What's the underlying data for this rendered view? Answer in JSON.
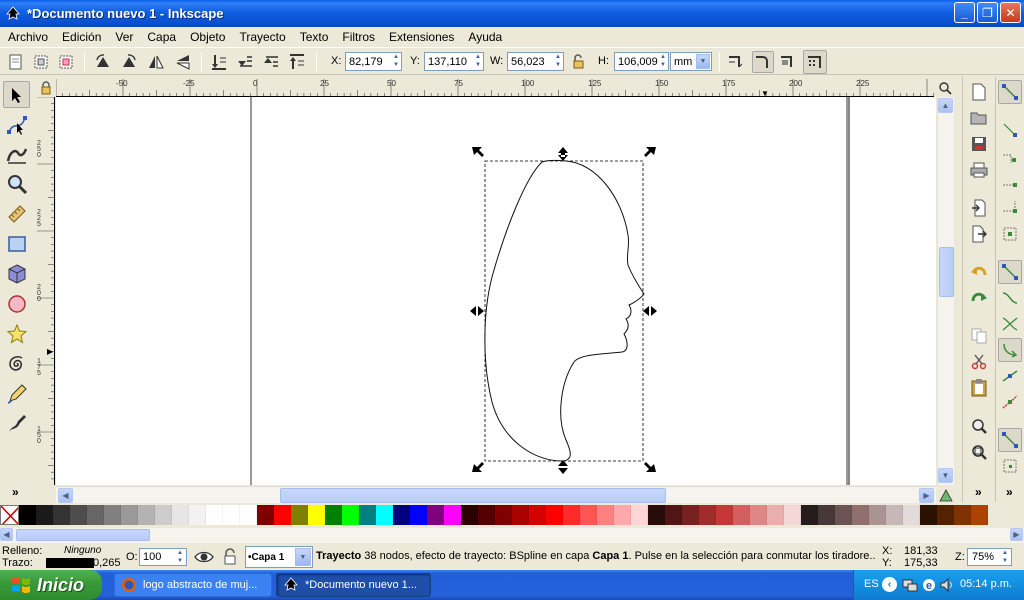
{
  "window": {
    "title": "*Documento nuevo 1 - Inkscape",
    "controls": [
      "_",
      "❐",
      "✕"
    ]
  },
  "menu": [
    "Archivo",
    "Edición",
    "Ver",
    "Capa",
    "Objeto",
    "Trayecto",
    "Texto",
    "Filtros",
    "Extensiones",
    "Ayuda"
  ],
  "controls": {
    "x_label": "X:",
    "x_value": "82,179",
    "y_label": "Y:",
    "y_value": "137,110",
    "w_label": "W:",
    "w_value": "56,023",
    "h_label": "H:",
    "h_value": "106,009",
    "unit": "mm"
  },
  "ruler": {
    "h_labels": [
      "-50",
      "-25",
      "0",
      "25",
      "50",
      "75",
      "100",
      "125",
      "150",
      "175",
      "200",
      "225"
    ],
    "v_labels": [
      "2 5 0",
      "2 2 5",
      "2 0 0",
      "1 7 5",
      "1 5 0"
    ]
  },
  "palette": {
    "colors": [
      "#000000",
      "#1a1a1a",
      "#333333",
      "#4d4d4d",
      "#666666",
      "#808080",
      "#999999",
      "#b3b3b3",
      "#cccccc",
      "#e6e6e6",
      "#f2f2f2",
      "#ffffff",
      "#ffffff",
      "#ffffff",
      "#800000",
      "#ff0000",
      "#808000",
      "#ffff00",
      "#008000",
      "#00ff00",
      "#008080",
      "#00ffff",
      "#000080",
      "#0000ff",
      "#800080",
      "#ff00ff",
      "#2b0000",
      "#550000",
      "#800000",
      "#aa0000",
      "#d40000",
      "#ff0000",
      "#ff2a2a",
      "#ff5555",
      "#ff8080",
      "#ffaaaa",
      "#ffd5d5",
      "#280b0b",
      "#501616",
      "#782121",
      "#a02c2c",
      "#c83737",
      "#d35f5f",
      "#de8787",
      "#e9afaf",
      "#f4d7d7",
      "#241c1c",
      "#483737",
      "#6c5353",
      "#916f6f",
      "#ac9393",
      "#c8b7b7",
      "#e3dbdb",
      "#2b1100",
      "#552200",
      "#803300",
      "#aa4400"
    ]
  },
  "status": {
    "fill_label": "Relleno:",
    "fill_value": "Ninguno",
    "stroke_label": "Trazo:",
    "stroke_width": "0,265",
    "opacity_label": "O:",
    "opacity_value": "100",
    "layer": "•Capa 1",
    "message_bold": "Trayecto",
    "message_rest": " 38 nodos, efecto de trayecto: BSpline en capa ",
    "message_layer": "Capa 1",
    "message_tail": ". Pulse en la selección para conmutar los tiradore...",
    "cursor_x_label": "X:",
    "cursor_x": "181,33",
    "cursor_y_label": "Y:",
    "cursor_y": "175,33",
    "zoom_label": "Z:",
    "zoom": "75%"
  },
  "taskbar": {
    "start": "Inicio",
    "tasks": [
      "logo abstracto de muj...",
      "*Documento nuevo 1..."
    ],
    "lang": "ES",
    "time": "05:14 p.m."
  },
  "colors": {
    "title_bar": "#0a50d0",
    "taskbar": "#245edb",
    "start_button": "#3a9b3a",
    "tray": "#138ee0"
  }
}
